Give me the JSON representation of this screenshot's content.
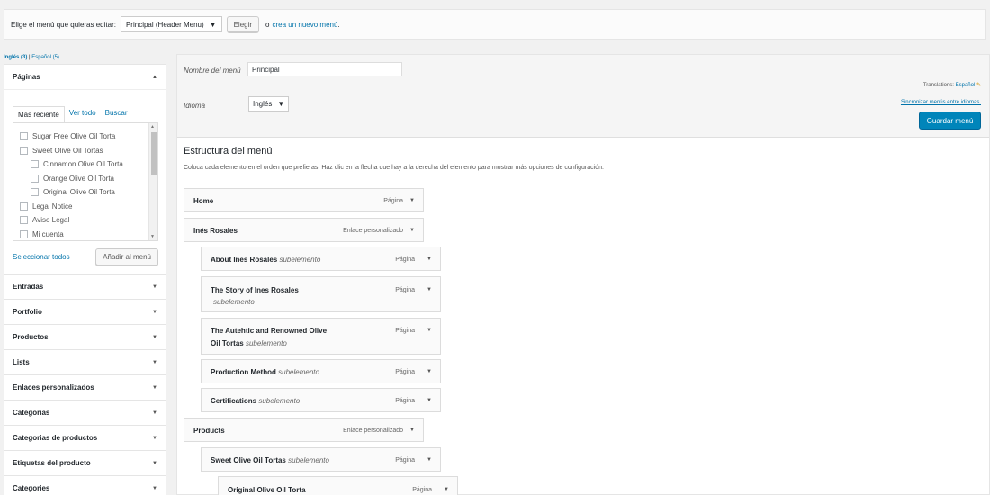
{
  "topbar": {
    "prompt": "Elige el menú que quieras editar:",
    "selected_menu": "Principal (Header Menu)",
    "select_button": "Elegir",
    "or_text": "o",
    "create_link": "crea un nuevo menú",
    "create_suffix": "."
  },
  "languages": {
    "current": "Inglés (3)",
    "separator": "|",
    "other": "Español (5)"
  },
  "pages_box": {
    "title": "Páginas",
    "tabs": [
      "Más reciente",
      "Ver todo",
      "Buscar"
    ],
    "items": [
      {
        "label": "Sugar Free Olive Oil Torta"
      },
      {
        "label": "Sweet Olive Oil Tortas"
      },
      {
        "label": "Cinnamon Olive Oil Torta"
      },
      {
        "label": "Orange Olive Oil Torta"
      },
      {
        "label": "Original Olive Oil Torta"
      },
      {
        "label": "Legal Notice"
      },
      {
        "label": "Aviso Legal"
      },
      {
        "label": "Mi cuenta"
      }
    ],
    "select_all": "Seleccionar todos",
    "add_button": "Añadir al menú"
  },
  "accordion": [
    "Entradas",
    "Portfolio",
    "Productos",
    "Lists",
    "Enlaces personalizados",
    "Categorias",
    "Categorias de productos",
    "Etiquetas del producto",
    "Categories"
  ],
  "menu_settings": {
    "name_label": "Nombre del menú",
    "name_value": "Principal",
    "lang_label": "Idioma",
    "lang_value": "Inglés",
    "translations_label": "Translations:",
    "translations_link": "Español",
    "sync_link": "Sincronizar menús entre idiomas.",
    "save_button": "Guardar menú"
  },
  "structure": {
    "title": "Estructura del menú",
    "description": "Coloca cada elemento en el orden que prefieras. Haz clic en la flecha que hay a la derecha del elemento para mostrar más opciones de configuración."
  },
  "menu_items": [
    {
      "title": "Home",
      "sub": "",
      "type": "Página"
    },
    {
      "title": "Inés Rosales",
      "sub": "",
      "type": "Enlace personalizado"
    },
    {
      "title": "About Ines Rosales",
      "sub": "subelemento",
      "type": "Página"
    },
    {
      "title": "The Story of Ines Rosales",
      "sub": "subelemento",
      "type": "Página"
    },
    {
      "title": "The Autehtic and Renowned Olive",
      "title2": "Oil Tortas",
      "sub": "subelemento",
      "type": "Página"
    },
    {
      "title": "Production Method",
      "sub": "subelemento",
      "type": "Página"
    },
    {
      "title": "Certifications",
      "sub": "subelemento",
      "type": "Página"
    },
    {
      "title": "Products",
      "sub": "",
      "type": "Enlace personalizado"
    },
    {
      "title": "Sweet Olive Oil Tortas",
      "sub": "subelemento",
      "type": "Página"
    },
    {
      "title": "Original Olive Oil Torta",
      "sub": "",
      "type": "Página"
    }
  ]
}
